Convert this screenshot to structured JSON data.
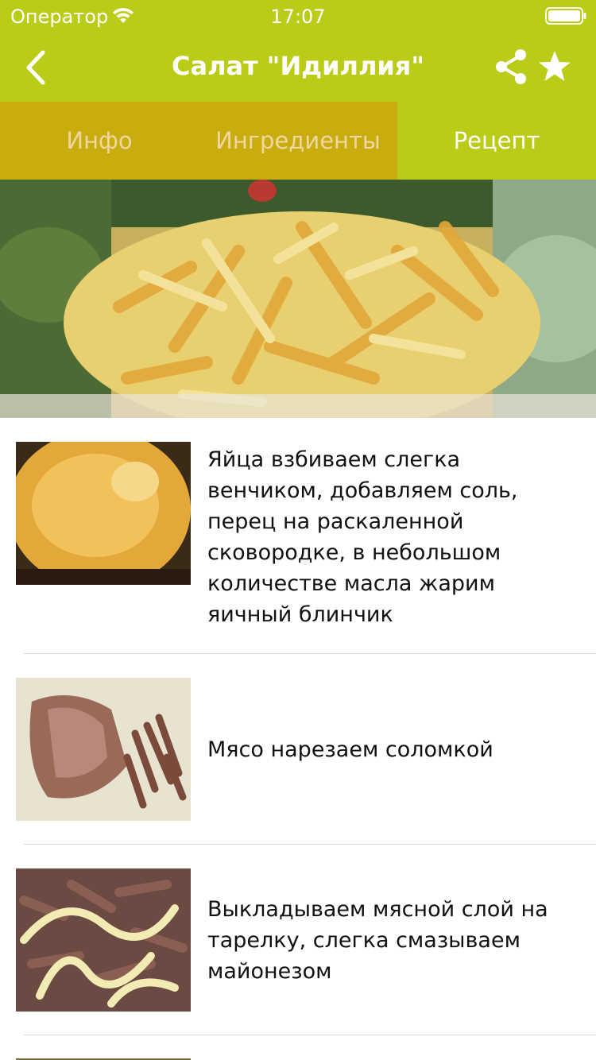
{
  "status_bar": {
    "carrier": "Оператор",
    "time": "17:07"
  },
  "nav": {
    "title": "Салат \"Идиллия\"",
    "back_icon": "chevron-left-icon",
    "share_icon": "share-icon",
    "favorite_icon": "star-icon"
  },
  "tabs": [
    {
      "label": "Инфо",
      "active": false
    },
    {
      "label": "Ингредиенты",
      "active": false
    },
    {
      "label": "Рецепт",
      "active": true
    }
  ],
  "steps": [
    {
      "text": "Яйца взбиваем слегка венчиком, добавляем соль, перец на раскаленной сковородке, в небольшом количестве масла жарим яичный блинчик"
    },
    {
      "text": "Мясо нарезаем соломкой"
    },
    {
      "text": "Выкладываем мясной слой на тарелку, слегка смазываем майонезом"
    }
  ],
  "colors": {
    "header": "#bacc17",
    "tab_inactive": "#c9ad0f",
    "tab_inactive_text": "#f0d6a0"
  }
}
